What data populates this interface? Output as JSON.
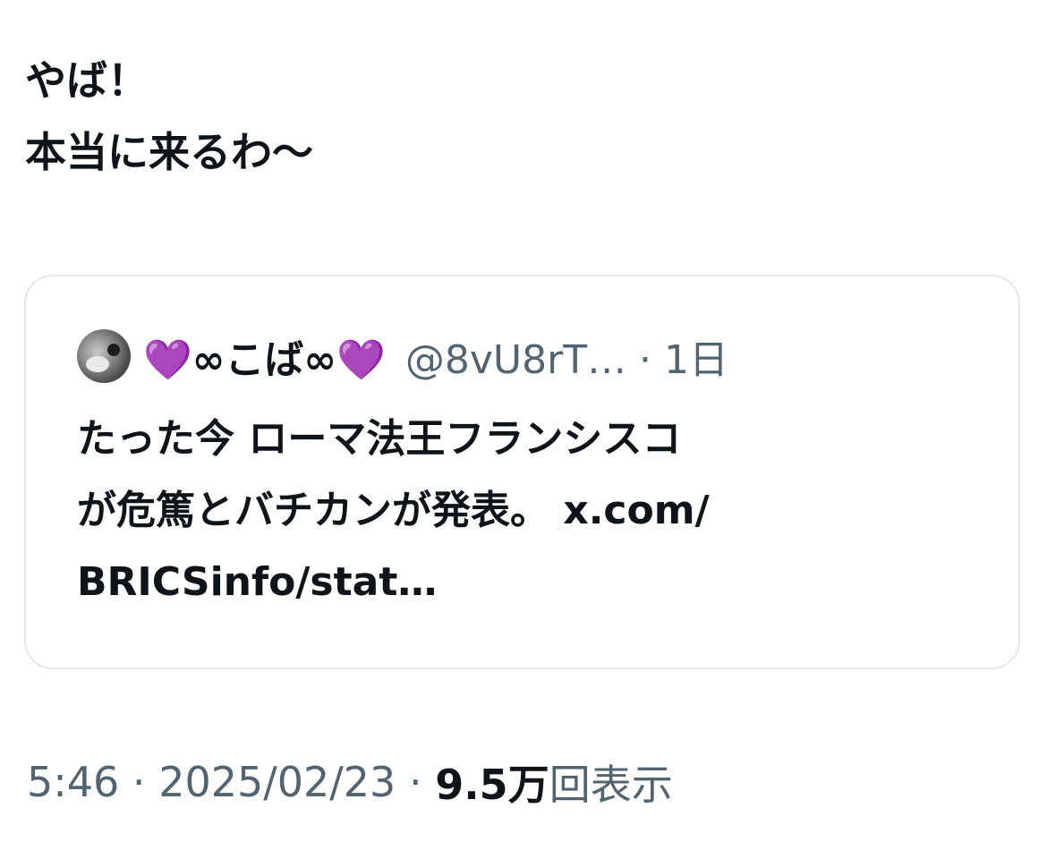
{
  "tweet": {
    "text_lines": [
      "やば！",
      "本当に来るわ〜"
    ]
  },
  "quote": {
    "avatar_icon": "user-avatar-icon",
    "display_name": "💜∞こば∞💜",
    "handle_and_time": "@8vU8rT… · 1日",
    "text_lines": [
      "たった今 ローマ法王フランシスコ",
      "が危篤とバチカンが発表。 x.com/",
      "BRICSinfo/stat…"
    ]
  },
  "meta": {
    "time": "5:46",
    "separator": " · ",
    "date": "2025/02/23",
    "views_count": "9.5万",
    "views_label": "回表示"
  },
  "colors": {
    "text": "#0f1419",
    "secondary": "#536471",
    "border": "#e3e7ea",
    "heart": "#a64cf0"
  }
}
